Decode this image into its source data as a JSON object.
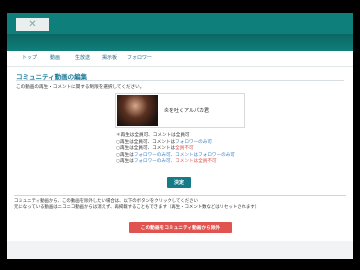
{
  "header": {
    "logo_glyph": "✕",
    "brand_color": "#0f7f7b"
  },
  "nav": {
    "items": [
      {
        "label": "トップ"
      },
      {
        "label": "動画"
      },
      {
        "label": "生放送"
      },
      {
        "label": "掲示板"
      },
      {
        "label": "フォロワー"
      }
    ]
  },
  "main": {
    "title": "コミュニティ動画の編集",
    "description": "この動画の再生・コメントに関する制限を選択してください。",
    "video": {
      "title": "炎を吐くアルパカ君"
    },
    "options": [
      {
        "mark": "＊",
        "prefix": "再生は全員可、コメントは全員可",
        "prefix_color": "plain",
        "middle": "",
        "middle_color": "plain",
        "suffix": "",
        "suffix_color": "plain"
      },
      {
        "mark": "○",
        "prefix": "再生は全員可、コメントは",
        "prefix_color": "plain",
        "middle": "フォロワーのみ可",
        "middle_color": "blue",
        "suffix": "",
        "suffix_color": "plain"
      },
      {
        "mark": "○",
        "prefix": "再生は全員可、コメントは",
        "prefix_color": "plain",
        "middle": "全員不可",
        "middle_color": "red",
        "suffix": "",
        "suffix_color": "plain"
      },
      {
        "mark": "○",
        "prefix": "再生は",
        "prefix_color": "plain",
        "middle": "フォロワーのみ可",
        "middle_color": "blue",
        "suffix": "、コメントはフォロワーのみ可",
        "suffix_color": "blue"
      },
      {
        "mark": "○",
        "prefix": "再生は",
        "prefix_color": "plain",
        "middle": "フォロワーのみ可",
        "middle_color": "blue",
        "suffix": "、コメントは全員不可",
        "suffix_color": "red"
      }
    ],
    "confirm_label": "決定"
  },
  "notice": {
    "line1": "コミュニティ動画から、この動画を除外したい場合は、以下のボタンをクリックしてください",
    "line2": "元になっている動画はニコニコ動画からは消えず、再掲載することもできます（再生・コメント数などはリセットされます）"
  },
  "remove_label": "この動画をコミュニティ動画から除外",
  "colors": {
    "blue_text": "#3b7fc4",
    "red_text": "#d9534f",
    "confirm_button": "#157b86",
    "remove_button": "#e0534f"
  }
}
